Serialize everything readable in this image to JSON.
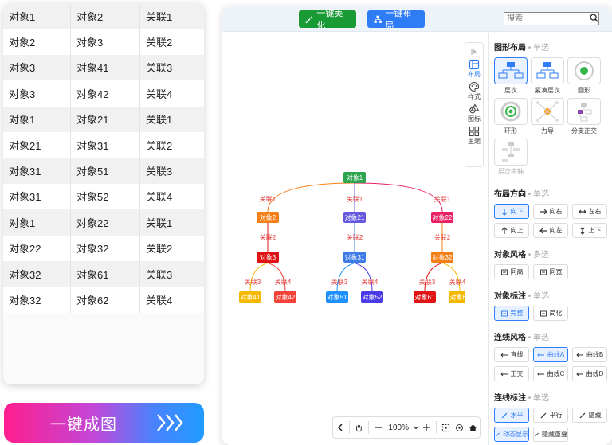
{
  "table": {
    "rows": [
      [
        "对象1",
        "对象2",
        "关联1"
      ],
      [
        "对象2",
        "对象3",
        "关联2"
      ],
      [
        "对象3",
        "对象41",
        "关联3"
      ],
      [
        "对象3",
        "对象42",
        "关联4"
      ],
      [
        "对象1",
        "对象21",
        "关联1"
      ],
      [
        "对象21",
        "对象31",
        "关联2"
      ],
      [
        "对象31",
        "对象51",
        "关联3"
      ],
      [
        "对象31",
        "对象52",
        "关联4"
      ],
      [
        "对象1",
        "对象22",
        "关联1"
      ],
      [
        "对象22",
        "对象32",
        "关联2"
      ],
      [
        "对象32",
        "对象61",
        "关联3"
      ],
      [
        "对象32",
        "对象62",
        "关联4"
      ]
    ]
  },
  "generate_button": {
    "label": "一键成图"
  },
  "toolbar": {
    "beautify_label": "一键美化",
    "layout_label": "一键布局",
    "search_placeholder": "搜索"
  },
  "side_tools": [
    {
      "label": "布局",
      "icon": "layout-icon",
      "active": true
    },
    {
      "label": "样式",
      "icon": "palette-icon",
      "active": false
    },
    {
      "label": "图标",
      "icon": "shapes-icon",
      "active": false
    },
    {
      "label": "主题",
      "icon": "grid-icon",
      "active": false
    }
  ],
  "bottom_tools": {
    "zoom": "100%"
  },
  "panel": {
    "layout_section": {
      "title": "图形布局",
      "sub": "• 单选",
      "items": [
        {
          "label": "层次",
          "active": true
        },
        {
          "label": "紧凑层次",
          "active": false
        },
        {
          "label": "圆形",
          "active": false
        },
        {
          "label": "环形",
          "active": false
        },
        {
          "label": "力导",
          "active": false
        },
        {
          "label": "分支正交",
          "active": false
        },
        {
          "label": "层次中轴",
          "active": false,
          "disabled": true
        }
      ]
    },
    "direction_section": {
      "title": "布局方向",
      "sub": "• 单选",
      "items": [
        {
          "label": "向下",
          "icon": "arrow-down-icon",
          "active": true
        },
        {
          "label": "向右",
          "icon": "arrow-right-icon",
          "active": false
        },
        {
          "label": "左右",
          "icon": "arrow-left-right-icon",
          "active": false
        },
        {
          "label": "向上",
          "icon": "arrow-up-icon",
          "active": false
        },
        {
          "label": "向左",
          "icon": "arrow-left-icon",
          "active": false
        },
        {
          "label": "上下",
          "icon": "arrow-up-down-icon",
          "active": false
        }
      ]
    },
    "style_section": {
      "title": "对象风格",
      "sub": "• 多选",
      "items": [
        {
          "label": "同高",
          "active": false
        },
        {
          "label": "同宽",
          "active": false
        }
      ]
    },
    "label_section": {
      "title": "对象标注",
      "sub": "• 单选",
      "items": [
        {
          "label": "完整",
          "active": true
        },
        {
          "label": "简化",
          "active": false
        }
      ]
    },
    "line_section": {
      "title": "连线风格",
      "sub": "• 单选",
      "items": [
        {
          "label": "直线",
          "active": false
        },
        {
          "label": "曲线A",
          "active": true
        },
        {
          "label": "曲线B",
          "active": false
        },
        {
          "label": "正交",
          "active": false
        },
        {
          "label": "曲线C",
          "active": false
        },
        {
          "label": "曲线D",
          "active": false
        }
      ]
    },
    "line_label_section": {
      "title": "连线标注",
      "sub": "• 单选",
      "items": [
        {
          "label": "水平",
          "active": true
        },
        {
          "label": "平行",
          "active": false
        },
        {
          "label": "隐藏",
          "active": false
        },
        {
          "label": "动态显示",
          "active": true
        },
        {
          "label": "隐藏重叠",
          "active": false
        }
      ]
    }
  },
  "graph": {
    "nodes": [
      {
        "id": "n1",
        "label": "对象1",
        "color": "#2da44e"
      },
      {
        "id": "n2",
        "label": "对象2",
        "color": "#f57f17"
      },
      {
        "id": "n21",
        "label": "对象21",
        "color": "#6659e0"
      },
      {
        "id": "n22",
        "label": "对象22",
        "color": "#e91e63"
      },
      {
        "id": "n3",
        "label": "对象3",
        "color": "#e01414"
      },
      {
        "id": "n31",
        "label": "对象31",
        "color": "#3f7ce8"
      },
      {
        "id": "n32",
        "label": "对象32",
        "color": "#f57f17"
      },
      {
        "id": "n41",
        "label": "对象41",
        "color": "#f5b800"
      },
      {
        "id": "n42",
        "label": "对象42",
        "color": "#f44336"
      },
      {
        "id": "n51",
        "label": "对象51",
        "color": "#1e90ff"
      },
      {
        "id": "n52",
        "label": "对象52",
        "color": "#4a3be8"
      },
      {
        "id": "n61",
        "label": "对象61",
        "color": "#e01414"
      },
      {
        "id": "n62",
        "label": "对象62",
        "color": "#f5b800"
      }
    ],
    "edges": [
      {
        "from": "n1",
        "to": "n2",
        "label": "关联1"
      },
      {
        "from": "n1",
        "to": "n21",
        "label": "关联1"
      },
      {
        "from": "n1",
        "to": "n22",
        "label": "关联1"
      },
      {
        "from": "n2",
        "to": "n3",
        "label": "关联2"
      },
      {
        "from": "n21",
        "to": "n31",
        "label": "关联2"
      },
      {
        "from": "n22",
        "to": "n32",
        "label": "关联2"
      },
      {
        "from": "n3",
        "to": "n41",
        "label": "关联3"
      },
      {
        "from": "n3",
        "to": "n42",
        "label": "关联4"
      },
      {
        "from": "n31",
        "to": "n51",
        "label": "关联3"
      },
      {
        "from": "n31",
        "to": "n52",
        "label": "关联4"
      },
      {
        "from": "n32",
        "to": "n61",
        "label": "关联3"
      },
      {
        "from": "n32",
        "to": "n62",
        "label": "关联4"
      }
    ]
  }
}
